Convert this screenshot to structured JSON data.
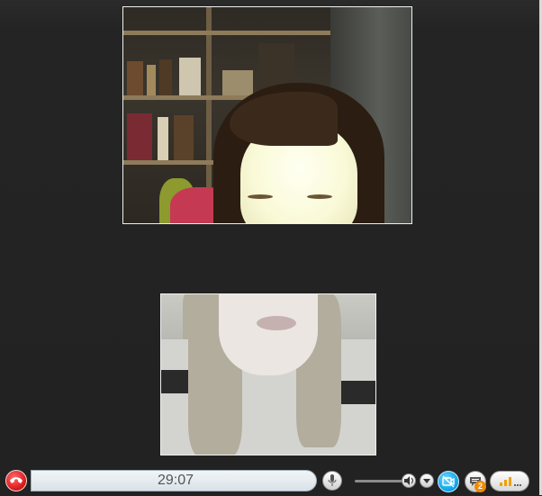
{
  "call": {
    "timer": "29:07",
    "notification_count": "2"
  },
  "icons": {
    "end_call": "phone-hangup-icon",
    "mic": "microphone-icon",
    "volume": "speaker-icon",
    "volume_menu": "chevron-down-icon",
    "video": "video-off-icon",
    "chat": "chat-bubble-icon",
    "quality": "signal-bars-icon"
  },
  "colors": {
    "end_call": "#d81414",
    "video": "#0aa0e6",
    "badge": "#f08a00",
    "signal": "#f0a000"
  }
}
